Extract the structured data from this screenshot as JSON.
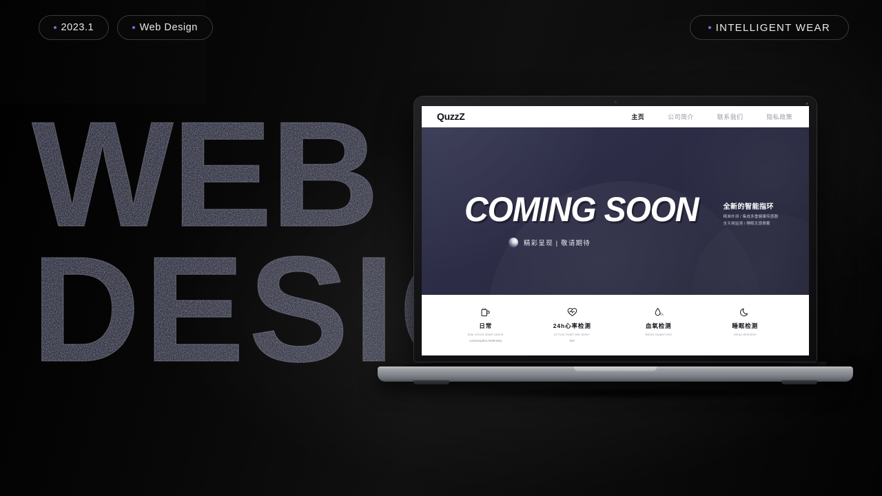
{
  "badges": {
    "left": [
      {
        "label": "2023.1",
        "icon": "bullet-dot"
      },
      {
        "label": "Web Design",
        "icon": "bullet-dot"
      }
    ],
    "right": {
      "label": "INTELLIGENT WEAR",
      "icon": "bullet-dot"
    }
  },
  "wordmark": {
    "line1": "WEB",
    "line2": "DESIGN"
  },
  "device": {
    "type": "laptop-macbook"
  },
  "site": {
    "logo": "QuzzZ",
    "nav": [
      {
        "label": "主页",
        "active": true
      },
      {
        "label": "公司简介",
        "active": false
      },
      {
        "label": "联系我们",
        "active": false
      },
      {
        "label": "隐私政策",
        "active": false
      }
    ],
    "hero": {
      "headline": "COMING SOON",
      "side_title": "全新的智能指环",
      "side_line1": "精准扑测 / 集成多重健康传感器",
      "side_line2": "全天候监测 / 睡眠无感佩戴",
      "tagline": "精彩呈现 | 敬请期待",
      "tagline_icon": "sphere-icon",
      "bg_color": "#2c2c46"
    },
    "features": [
      {
        "icon": "cup-icon",
        "title": "日常",
        "en": "Day record steps calorie",
        "sub": "consumption,sedentary"
      },
      {
        "icon": "heart-rate-icon",
        "title": "24h心率检测",
        "en": "24 hour heart rate detec-",
        "sub": "tion"
      },
      {
        "icon": "blood-drop-icon",
        "title": "血氧检测",
        "en": "Blood oxygen test",
        "sub": ""
      },
      {
        "icon": "moon-icon",
        "title": "睡眠检测",
        "en": "Sleep detection",
        "sub": ""
      }
    ]
  },
  "colors": {
    "page_bg": "#000000",
    "accent": "#6b73d8",
    "hero_bg": "#2c2c46",
    "badge_border": "#3a3a3a"
  }
}
